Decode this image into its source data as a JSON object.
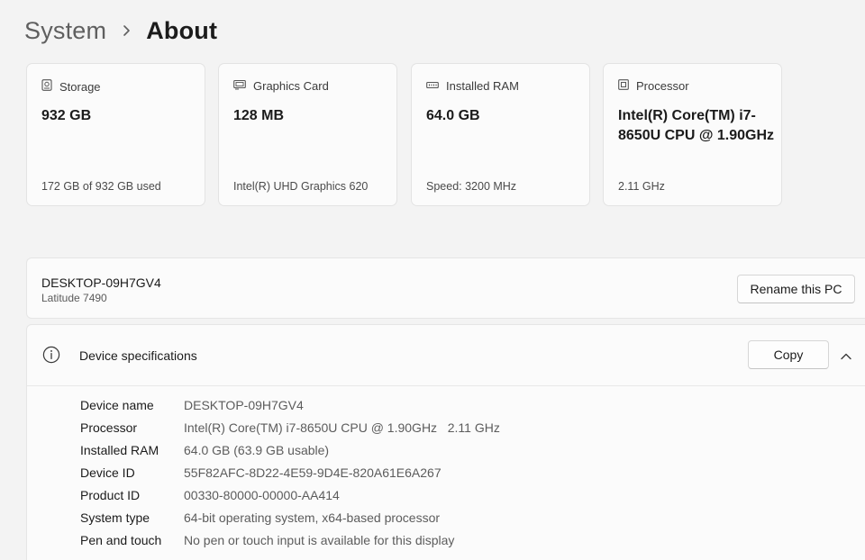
{
  "breadcrumb": {
    "parent": "System",
    "separator_icon": "chevron-right-icon",
    "current": "About"
  },
  "cards": [
    {
      "icon": "storage-icon",
      "title": "Storage",
      "value": "932 GB",
      "sub": "172 GB of 932 GB used"
    },
    {
      "icon": "graphics-card-icon",
      "title": "Graphics Card",
      "value": "128 MB",
      "sub": "Intel(R) UHD Graphics 620"
    },
    {
      "icon": "ram-icon",
      "title": "Installed RAM",
      "value": "64.0 GB",
      "sub": "Speed: 3200 MHz"
    },
    {
      "icon": "processor-icon",
      "title": "Processor",
      "value": "Intel(R) Core(TM) i7-8650U CPU @ 1.90GHz",
      "sub": "2.11 GHz"
    }
  ],
  "pc": {
    "name": "DESKTOP-09H7GV4",
    "model": "Latitude 7490",
    "rename_label": "Rename this PC"
  },
  "device_specs": {
    "icon": "info-icon",
    "title": "Device specifications",
    "copy_label": "Copy",
    "collapse_icon": "chevron-up-icon",
    "rows": [
      {
        "label": "Device name",
        "value": "DESKTOP-09H7GV4"
      },
      {
        "label": "Processor",
        "value": "Intel(R) Core(TM) i7-8650U CPU @ 1.90GHz   2.11 GHz"
      },
      {
        "label": "Installed RAM",
        "value": "64.0 GB (63.9 GB usable)"
      },
      {
        "label": "Device ID",
        "value": "55F82AFC-8D22-4E59-9D4E-820A61E6A267"
      },
      {
        "label": "Product ID",
        "value": "00330-80000-00000-AA414"
      },
      {
        "label": "System type",
        "value": "64-bit operating system, x64-based processor"
      },
      {
        "label": "Pen and touch",
        "value": "No pen or touch input is available for this display"
      }
    ]
  }
}
